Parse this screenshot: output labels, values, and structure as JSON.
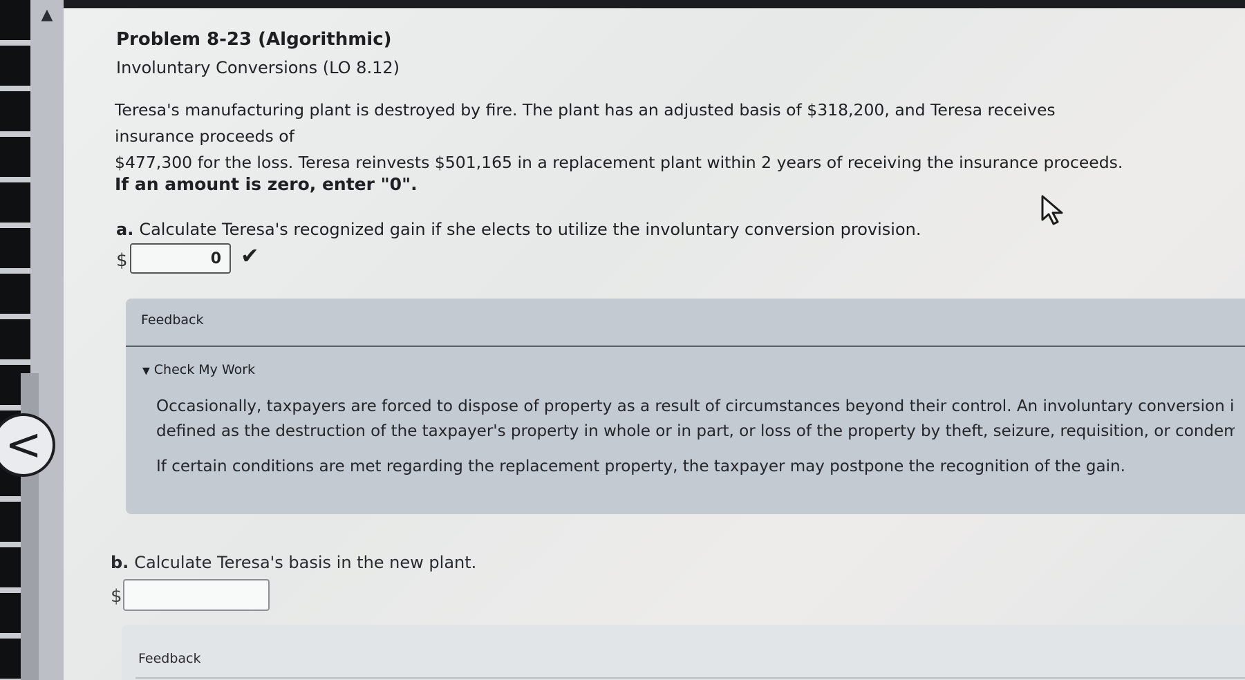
{
  "problem": {
    "title": "Problem 8-23 (Algorithmic)",
    "subtitle": "Involuntary Conversions (LO 8.12)",
    "text_line1": "Teresa's manufacturing plant is destroyed by fire. The plant has an adjusted basis of $318,200, and Teresa receives insurance proceeds of",
    "text_line2": "$477,300 for the loss. Teresa reinvests $501,165 in a replacement plant within 2 years of receiving the insurance proceeds.",
    "instruction": "If an amount is zero, enter \"0\"."
  },
  "part_a": {
    "letter": "a.",
    "question": "Calculate Teresa's recognized gain if she elects to utilize the involuntary conversion provision.",
    "currency": "$",
    "value": "0",
    "status_icon": "checkmark-icon"
  },
  "feedback_a": {
    "heading": "Feedback",
    "toggle_label": "Check My Work",
    "para1_line1": "Occasionally, taxpayers are forced to dispose of property as a result of circumstances beyond their control. An involuntary conversion is",
    "para1_line2": "defined as the destruction of the taxpayer's property in whole or in part, or loss of the property by theft, seizure, requisition, or condemr",
    "para2": "If certain conditions are met regarding the replacement property, the taxpayer may postpone the recognition of the gain."
  },
  "part_b": {
    "letter": "b.",
    "question": "Calculate Teresa's basis in the new plant.",
    "currency": "$",
    "value": ""
  },
  "feedback_b": {
    "heading": "Feedback"
  },
  "nav": {
    "back_glyph": "<",
    "scroll_up_glyph": "▲"
  },
  "colors": {
    "feedback_bg": "#c3cad1",
    "page_bg": "#eef0f0"
  }
}
